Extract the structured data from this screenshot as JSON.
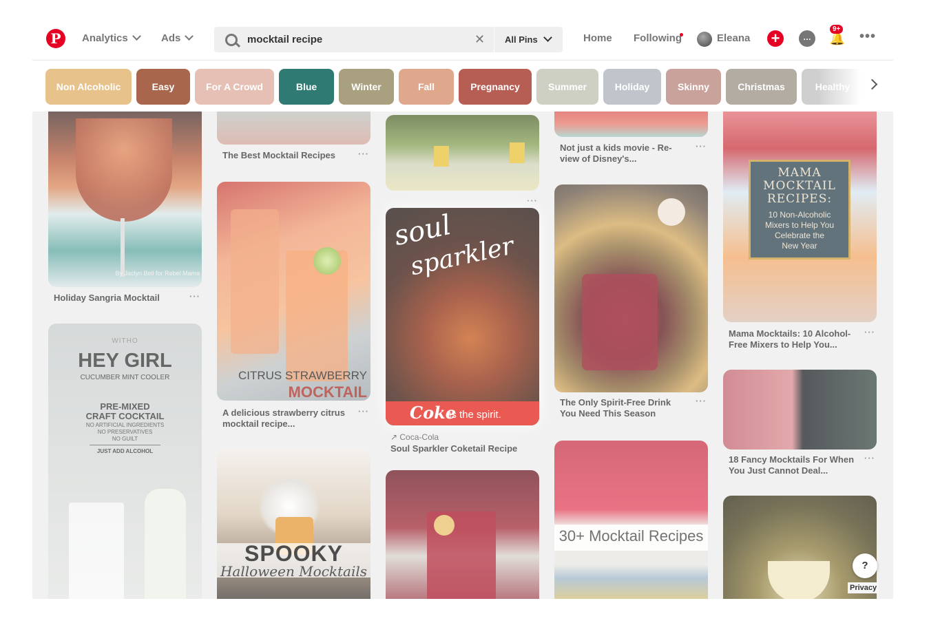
{
  "header": {
    "logo": "P",
    "analytics_label": "Analytics",
    "ads_label": "Ads",
    "search_value": "mocktail recipe",
    "clear_glyph": "✕",
    "scope_label": "All Pins",
    "home_label": "Home",
    "following_label": "Following",
    "user_name": "Eleana",
    "add_glyph": "+",
    "messages_glyph": "…",
    "notif_glyph": "🔔",
    "notif_badge": "9+",
    "more_glyph": "•••"
  },
  "chips": [
    {
      "label": "Non Alcoholic",
      "color": "#e7c28a"
    },
    {
      "label": "Easy",
      "color": "#a8674c"
    },
    {
      "label": "For A Crowd",
      "color": "#e6c0b5"
    },
    {
      "label": "Blue",
      "color": "#2f7a72"
    },
    {
      "label": "Winter",
      "color": "#a8a07e"
    },
    {
      "label": "Fall",
      "color": "#dfa88c"
    },
    {
      "label": "Pregnancy",
      "color": "#b75e54"
    },
    {
      "label": "Summer",
      "color": "#cfd0c4"
    },
    {
      "label": "Holiday",
      "color": "#bfc5cb"
    },
    {
      "label": "Skinny",
      "color": "#c9a29c"
    },
    {
      "label": "Christmas",
      "color": "#b2aca3"
    },
    {
      "label": "Healthy",
      "color": "#cfcfcf"
    }
  ],
  "pins": {
    "p1": {
      "title": "Holiday Sangria Mocktail",
      "credit": "By Jaclyn Bell for Rebel Mama",
      "more": "···"
    },
    "p2": {
      "brand": "WITHO",
      "heading": "HEY GIRL",
      "sub": "CUCUMBER MINT COOLER",
      "line1": "PRE-MIXED",
      "line2": "CRAFT COCKTAIL",
      "line3": "NO ARTIFICIAL INGREDIENTS",
      "line4": "NO PRESERVATIVES",
      "line5": "NO GUILT",
      "line6": "JUST ADD ALCOHOL"
    },
    "p3": {
      "title": "The Best Mocktail Recipes",
      "more": "···"
    },
    "p4": {
      "overlay1": "CITRUS STRAWBERRY",
      "overlay2": "MOCKTAIL",
      "title_l1": "A delicious strawberry citrus",
      "title_l2": "mocktail recipe...",
      "more": "···"
    },
    "p5": {
      "overlay1": "SPOOKY",
      "overlay2": "Halloween Mocktails"
    },
    "p6": {
      "more": "···"
    },
    "p7": {
      "script1": "soul",
      "script2": "sparkler",
      "coke": "Coke",
      "tagline": "is the spirit.",
      "source": "↗ Coca-Cola",
      "title": "Soul Sparkler Coketail Recipe"
    },
    "p8": {
      "title_l1": "Not just a kids movie - Re-",
      "title_l2": "view of Disney's...",
      "more": "···"
    },
    "p9": {
      "title_l1": "The Only Spirit-Free Drink",
      "title_l2": "You Need This Season",
      "more": "···"
    },
    "p10": {
      "overlay": "30+ Mocktail Recipes"
    },
    "p11": {
      "o1": "MAMA",
      "o2": "MOCKTAIL",
      "o3": "RECIPES:",
      "o4": "10 Non-Alcoholic",
      "o5": "Mixers to Help You",
      "o6": "Celebrate the",
      "o7": "New Year",
      "title_l1": "Mama Mocktails: 10 Alcohol-",
      "title_l2": "Free Mixers to Help You...",
      "more": "···"
    },
    "p12": {
      "title_l1": "18 Fancy Mocktails For When",
      "title_l2": "You Just Cannot Deal...",
      "more": "···"
    }
  },
  "help_label": "?",
  "privacy_label": "Privacy"
}
